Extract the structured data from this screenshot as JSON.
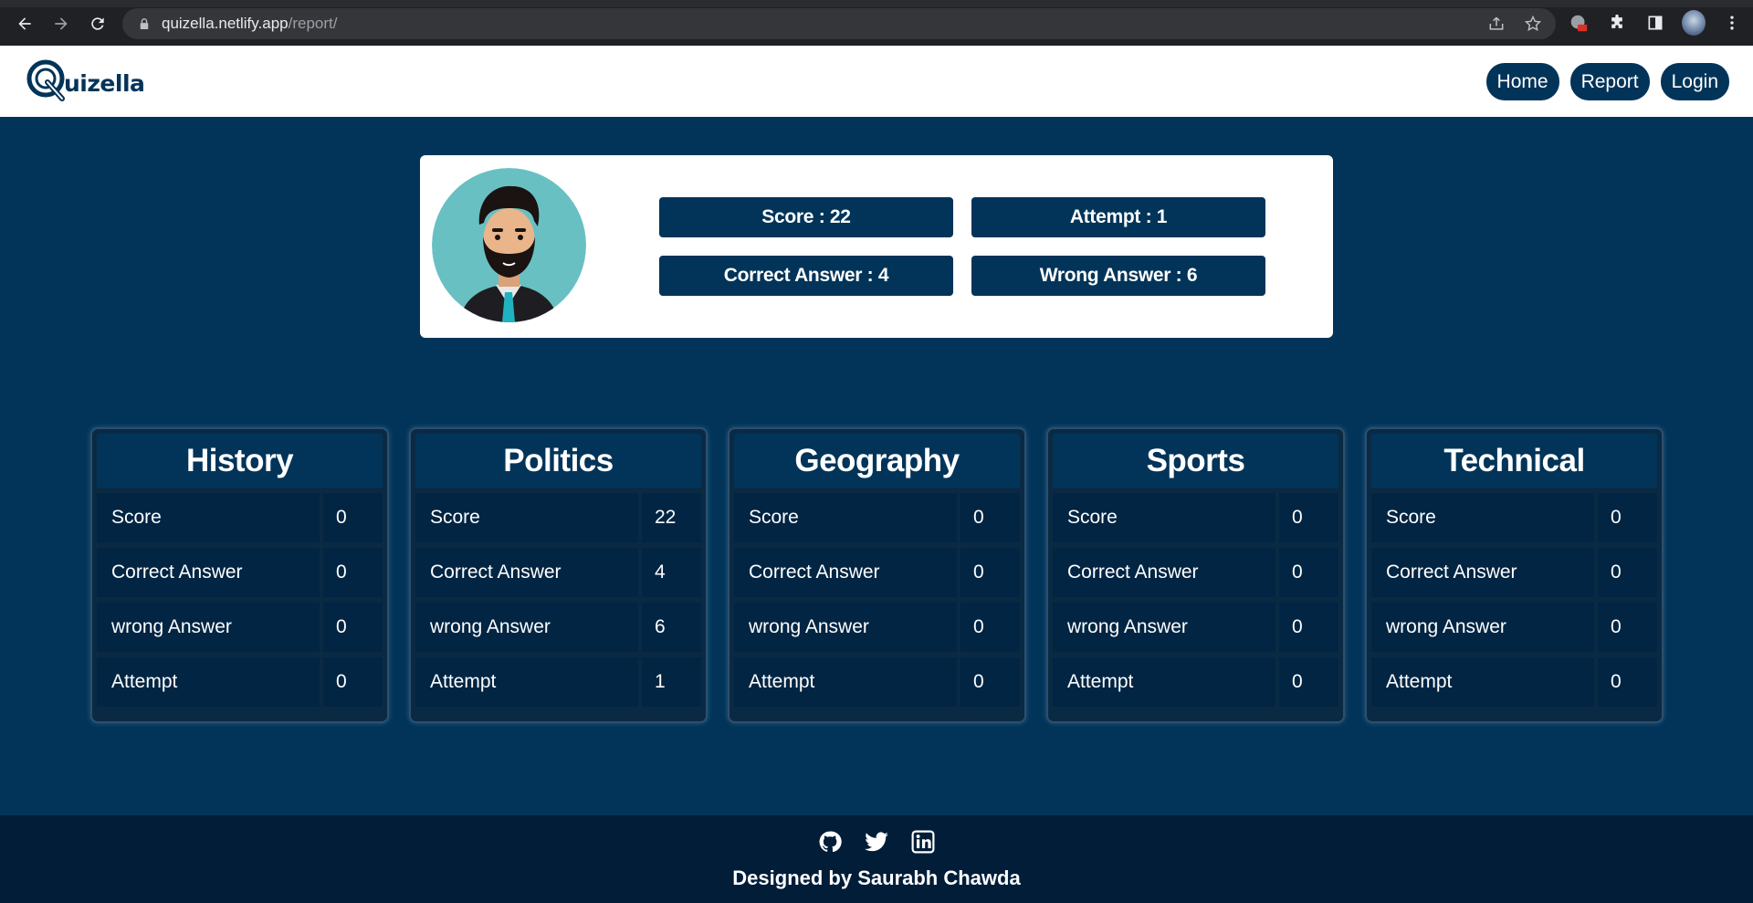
{
  "browser": {
    "url_domain": "quizella.netlify.app",
    "url_path": "/report/"
  },
  "header": {
    "logo_text": "uizella",
    "nav": [
      "Home",
      "Report",
      "Login"
    ]
  },
  "summary": {
    "score": "Score : 22",
    "attempt": "Attempt : 1",
    "correct": "Correct Answer : 4",
    "wrong": "Wrong Answer : 6"
  },
  "categories": [
    {
      "name": "History",
      "rows": [
        [
          "Score",
          "0"
        ],
        [
          "Correct Answer",
          "0"
        ],
        [
          "wrong Answer",
          "0"
        ],
        [
          "Attempt",
          "0"
        ]
      ]
    },
    {
      "name": "Politics",
      "rows": [
        [
          "Score",
          "22"
        ],
        [
          "Correct Answer",
          "4"
        ],
        [
          "wrong Answer",
          "6"
        ],
        [
          "Attempt",
          "1"
        ]
      ]
    },
    {
      "name": "Geography",
      "rows": [
        [
          "Score",
          "0"
        ],
        [
          "Correct Answer",
          "0"
        ],
        [
          "wrong Answer",
          "0"
        ],
        [
          "Attempt",
          "0"
        ]
      ]
    },
    {
      "name": "Sports",
      "rows": [
        [
          "Score",
          "0"
        ],
        [
          "Correct Answer",
          "0"
        ],
        [
          "wrong Answer",
          "0"
        ],
        [
          "Attempt",
          "0"
        ]
      ]
    },
    {
      "name": "Technical",
      "rows": [
        [
          "Score",
          "0"
        ],
        [
          "Correct Answer",
          "0"
        ],
        [
          "wrong Answer",
          "0"
        ],
        [
          "Attempt",
          "0"
        ]
      ]
    }
  ],
  "footer": {
    "credit": "Designed by Saurabh Chawda",
    "icons": [
      "github-icon",
      "twitter-icon",
      "linkedin-icon"
    ]
  },
  "colors": {
    "primary": "#023459",
    "page_bg": "#023459",
    "footer_bg": "#011d38",
    "card_bg": "#ffffff"
  }
}
